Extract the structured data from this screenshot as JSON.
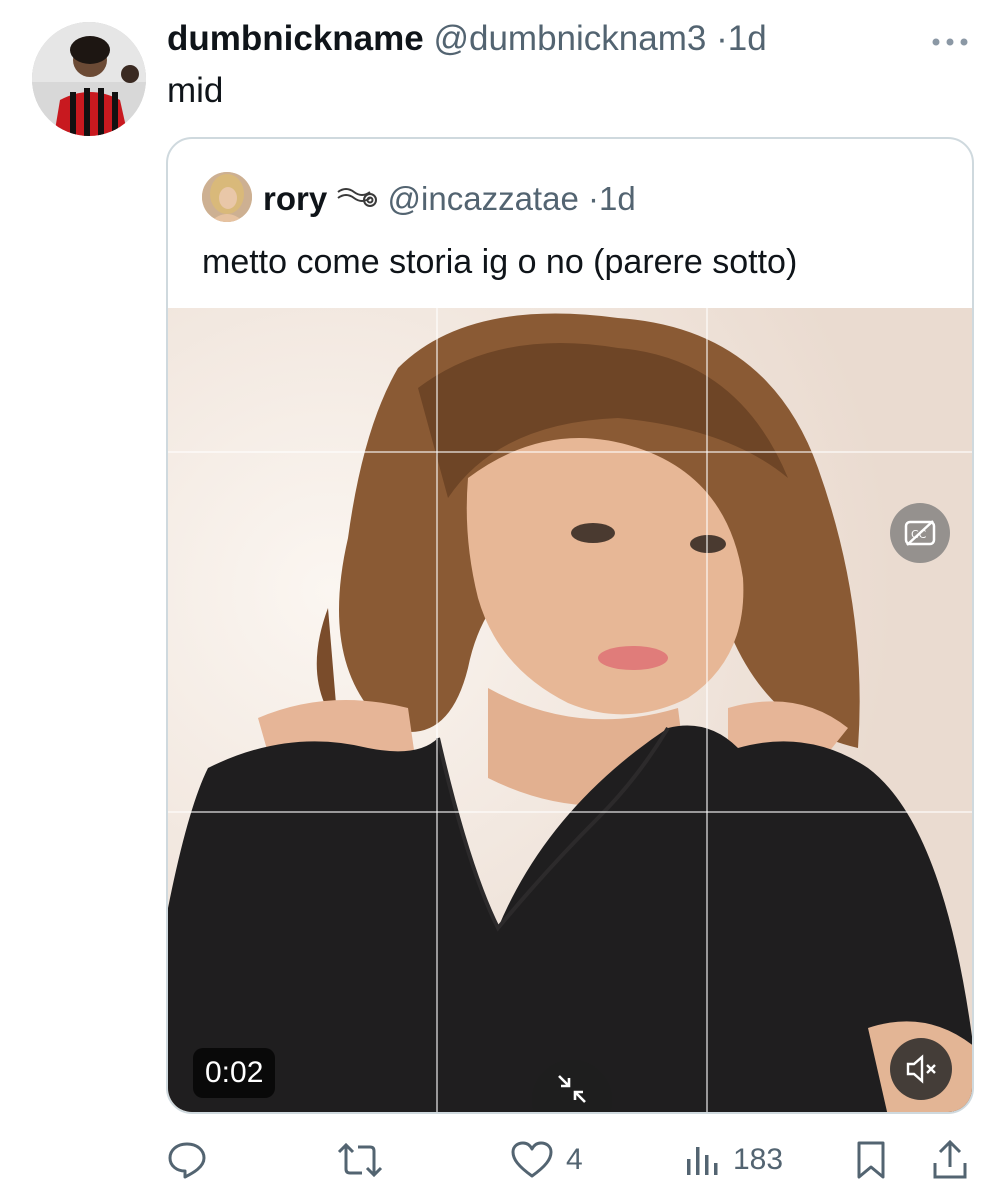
{
  "tweet": {
    "author_name": "dumbnickname",
    "author_handle": "@dumbnicknam3",
    "separator": "·",
    "time": "1d",
    "text": "mid",
    "more_icon": "more-icon"
  },
  "quoted_tweet": {
    "author_name": "rory",
    "author_decoration": "swirl-emoji",
    "author_handle": "@incazzatae",
    "separator": "·",
    "time": "1d",
    "text": "metto come storia ig o no (parere sotto)",
    "video": {
      "duration": "0:02",
      "captions_icon": "captions-off-icon",
      "collapse_icon": "collapse-icon",
      "mute_icon": "speaker-muted-icon"
    }
  },
  "actions": {
    "reply": {
      "icon": "reply-icon",
      "count": ""
    },
    "retweet": {
      "icon": "retweet-icon",
      "count": ""
    },
    "like": {
      "icon": "heart-icon",
      "count": "4"
    },
    "views": {
      "icon": "views-icon",
      "count": "183"
    },
    "bookmark": {
      "icon": "bookmark-icon"
    },
    "share": {
      "icon": "share-icon"
    }
  },
  "colors": {
    "text_primary": "#0f1419",
    "text_secondary": "#536471",
    "border": "#cfd9de"
  }
}
